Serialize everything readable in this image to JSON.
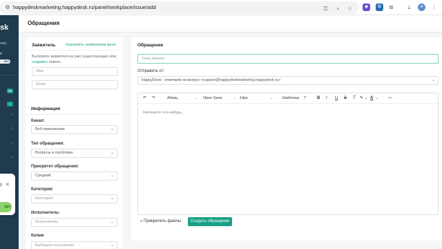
{
  "browser": {
    "url": "happydeskmarketing.happydesk.ru/panel/workplace/issue/add",
    "icons": [
      "site-info-icon",
      "key-icon",
      "zoom-icon",
      "star-icon",
      "download-icon",
      "profile-icon",
      "menu-icon"
    ]
  },
  "sidebar": {
    "logo": "sk",
    "text1": "тем,",
    "text2": "й",
    "pill_label": "айн",
    "badge1": "56",
    "badge2": "1"
  },
  "toast": {
    "text": "y",
    "button_label": "арт"
  },
  "page": {
    "title": "Обращения"
  },
  "requester": {
    "title": "Заявитель",
    "assign_link": "Назначить заявителем меня",
    "hint_prefix": "Выберите заявителя из уже существующих или",
    "hint_link": "создайте",
    "hint_suffix": "нового.",
    "name_placeholder": "Имя",
    "email_placeholder": "Email"
  },
  "info": {
    "title": "Информация",
    "channel_label": "Канал:",
    "channel_value": "Веб-приложение",
    "type_label": "Тип обращения:",
    "type_value": "Вопросы и проблемы",
    "priority_label": "Приоритет обращения:",
    "priority_value": "Средний",
    "category_label": "Категория:",
    "category_placeholder": "Категория",
    "assignee_label": "Исполнитель:",
    "assignee_placeholder": "Исполнитель",
    "copies_label": "Копии",
    "copies_placeholder": "Выберите получателя"
  },
  "ticket": {
    "section_title": "Обращение",
    "subject_placeholder": "Тема письма",
    "from_label": "Отправить от:",
    "from_value": "HappyDesk - отвечаем на вопрос <support@happydeskmarketing.happydesk.ru>",
    "toolbar": {
      "paragraph": "Абзац",
      "font": "Open Sans",
      "size": "14px",
      "templates": "Шаблоны",
      "help": "?"
    },
    "body_placeholder": "Напишите что-нибудь...",
    "attach_label": "Прикрепить файлы",
    "submit_label": "Создать обращение"
  },
  "colors": {
    "accent": "#18a086",
    "sidebar_bg": "#1f3b4d",
    "toast_button": "#8cd36a"
  }
}
